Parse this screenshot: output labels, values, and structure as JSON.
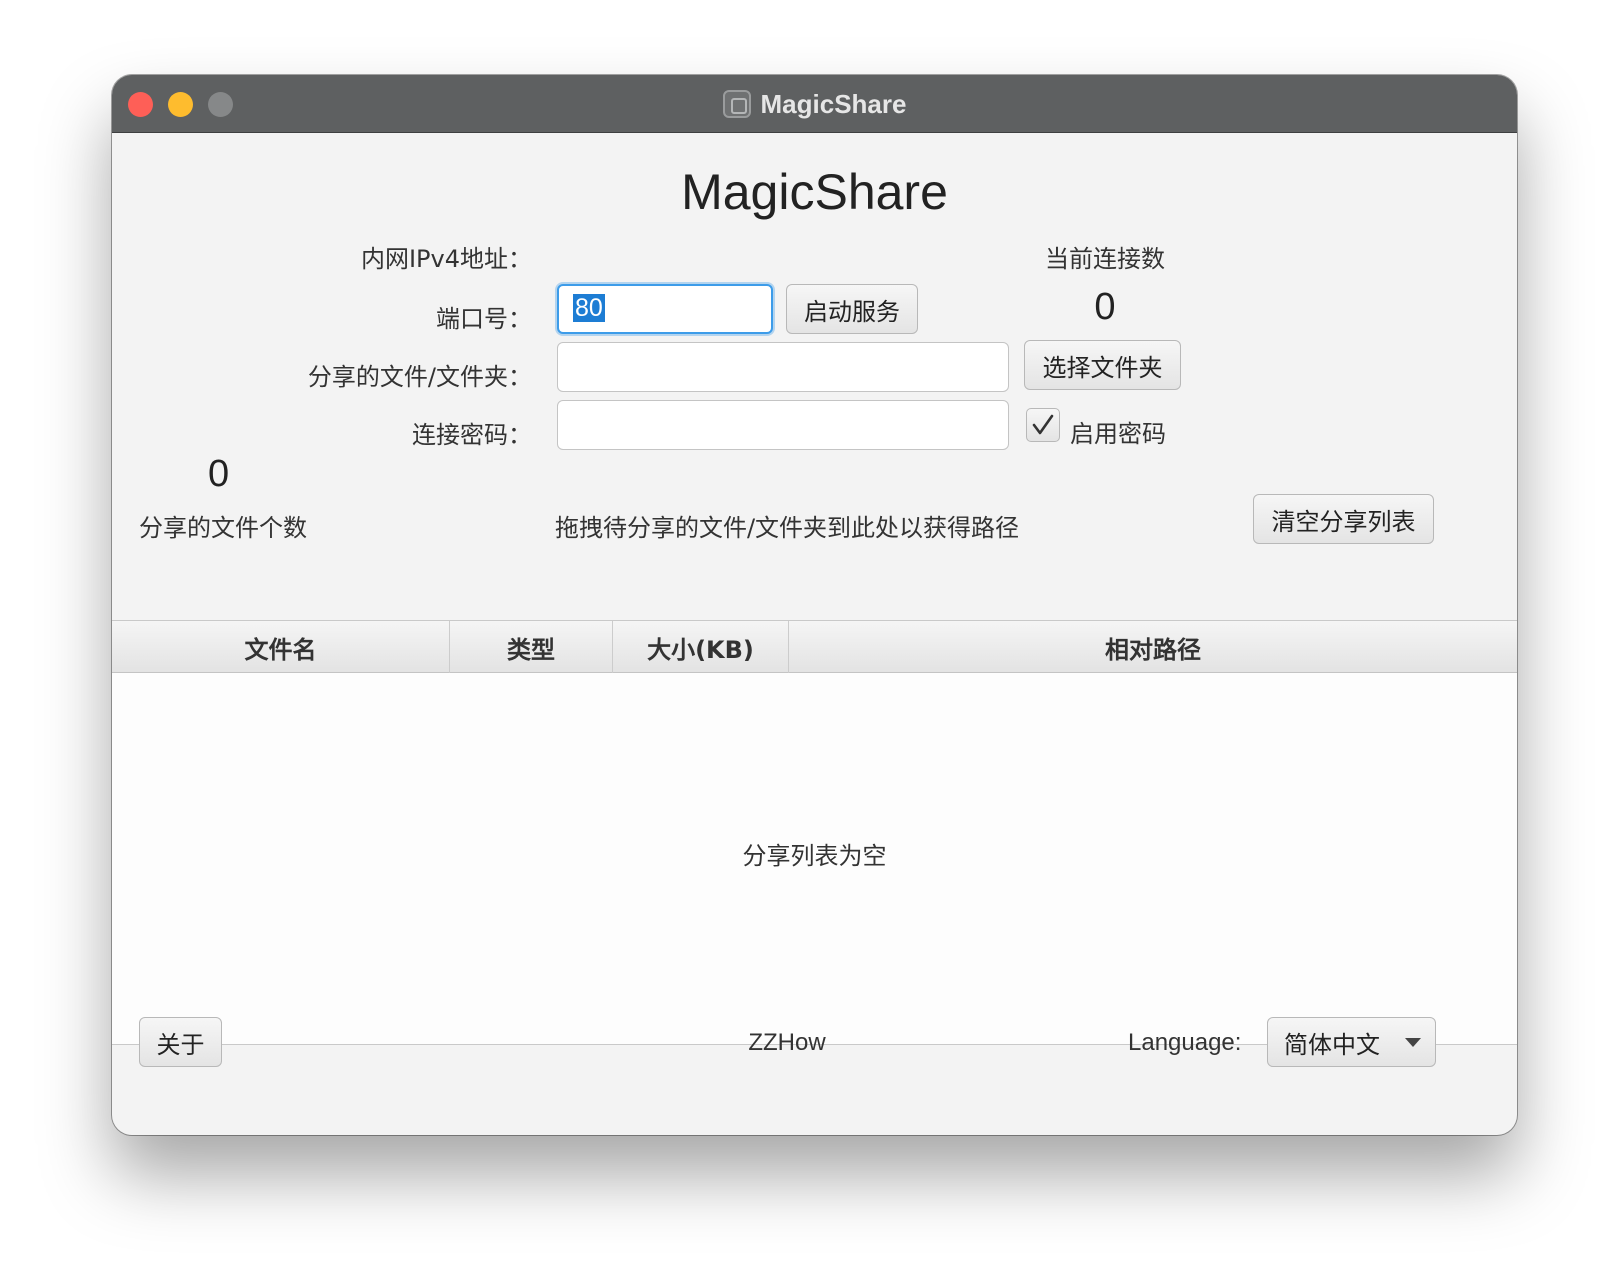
{
  "window": {
    "title": "MagicShare",
    "controls": [
      "close",
      "minimize",
      "maximize"
    ]
  },
  "header": {
    "title": "MagicShare"
  },
  "form": {
    "ipv4_label": "内网IPv4地址：",
    "ipv4_value": "",
    "connections_label": "当前连接数",
    "connections_value": "0",
    "port_label": "端口号：",
    "port_value": "80",
    "start_service_button": "启动服务",
    "shared_path_label": "分享的文件/文件夹：",
    "shared_path_value": "",
    "choose_folder_button": "选择文件夹",
    "password_label": "连接密码：",
    "password_value": "",
    "enable_password_checked": true,
    "enable_password_label": "启用密码"
  },
  "file_summary": {
    "count": "0",
    "count_label": "分享的文件个数",
    "drop_hint": "拖拽待分享的文件/文件夹到此处以获得路径",
    "clear_button": "清空分享列表"
  },
  "table": {
    "columns": [
      "文件名",
      "类型",
      "大小(KB)",
      "相对路径"
    ],
    "rows": [],
    "empty_text": "分享列表为空"
  },
  "footer": {
    "about_button": "关于",
    "author": "ZZHow",
    "language_label": "Language:",
    "language_selected": "简体中文"
  },
  "colors": {
    "titlebar": "#5e6061",
    "close": "#fe5f57",
    "minimize": "#febc2e",
    "maximize": "#868889",
    "focus_ring": "#3d9ce9",
    "selection": "#1d7dd4"
  }
}
